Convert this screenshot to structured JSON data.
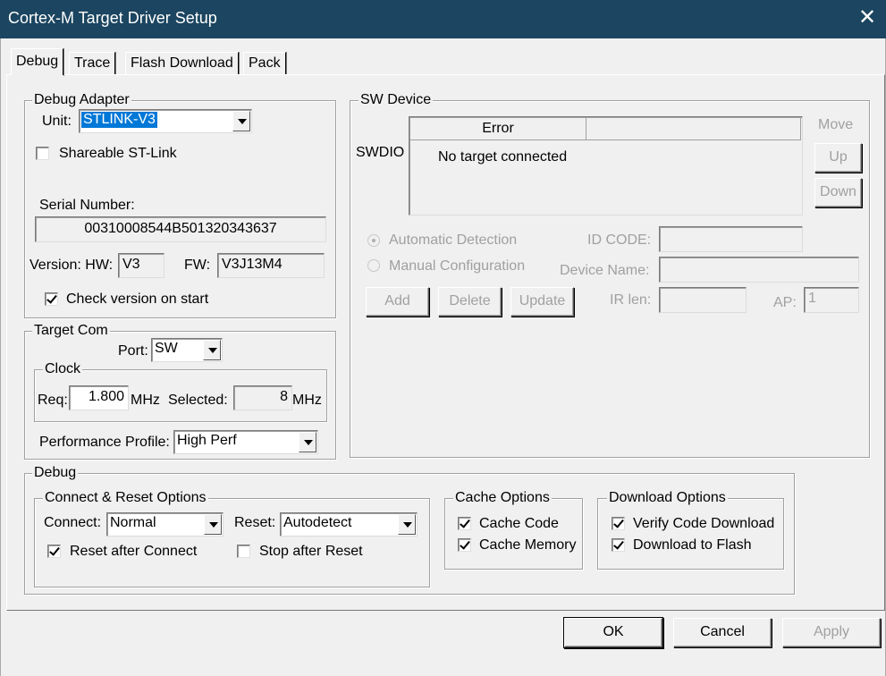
{
  "window": {
    "title": "Cortex-M Target Driver Setup",
    "close": "✕"
  },
  "tabs": [
    "Debug",
    "Trace",
    "Flash Download",
    "Pack"
  ],
  "debug_adapter": {
    "title": "Debug Adapter",
    "unit_label": "Unit:",
    "unit_value": "STLINK-V3",
    "shareable_label": "Shareable ST-Link",
    "serial_label": "Serial Number:",
    "serial_value": "00310008544B501320343637",
    "version_label": "Version: HW:",
    "hw_value": "V3",
    "fw_label": "FW:",
    "fw_value": "V3J13M4",
    "check_version_label": "Check version on start"
  },
  "target_com": {
    "title": "Target Com",
    "port_label": "Port:",
    "port_value": "SW",
    "clock_title": "Clock",
    "req_label": "Req:",
    "req_value": "1.800",
    "mhz": "MHz",
    "selected_label": "Selected:",
    "selected_value": "8",
    "perf_label": "Performance Profile:",
    "perf_value": "High Perf"
  },
  "sw_device": {
    "title": "SW Device",
    "swdio_label": "SWDIO",
    "col_error": "Error",
    "col_blank": "",
    "message": "No target connected",
    "move_label": "Move",
    "up": "Up",
    "down": "Down",
    "auto_detect": "Automatic Detection",
    "manual_config": "Manual Configuration",
    "id_code_label": "ID CODE:",
    "device_name_label": "Device Name:",
    "ir_len_label": "IR len:",
    "ap_label": "AP:",
    "ap_value": "1",
    "add": "Add",
    "delete": "Delete",
    "update": "Update"
  },
  "debug": {
    "title": "Debug",
    "connect_reset": {
      "title": "Connect & Reset Options",
      "connect_label": "Connect:",
      "connect_value": "Normal",
      "reset_label": "Reset:",
      "reset_value": "Autodetect",
      "reset_after_connect": "Reset after Connect",
      "stop_after_reset": "Stop after Reset"
    },
    "cache": {
      "title": "Cache Options",
      "code": "Cache Code",
      "memory": "Cache Memory"
    },
    "download": {
      "title": "Download Options",
      "verify": "Verify Code Download",
      "to_flash": "Download to Flash"
    }
  },
  "buttons": {
    "ok": "OK",
    "cancel": "Cancel",
    "apply": "Apply"
  }
}
